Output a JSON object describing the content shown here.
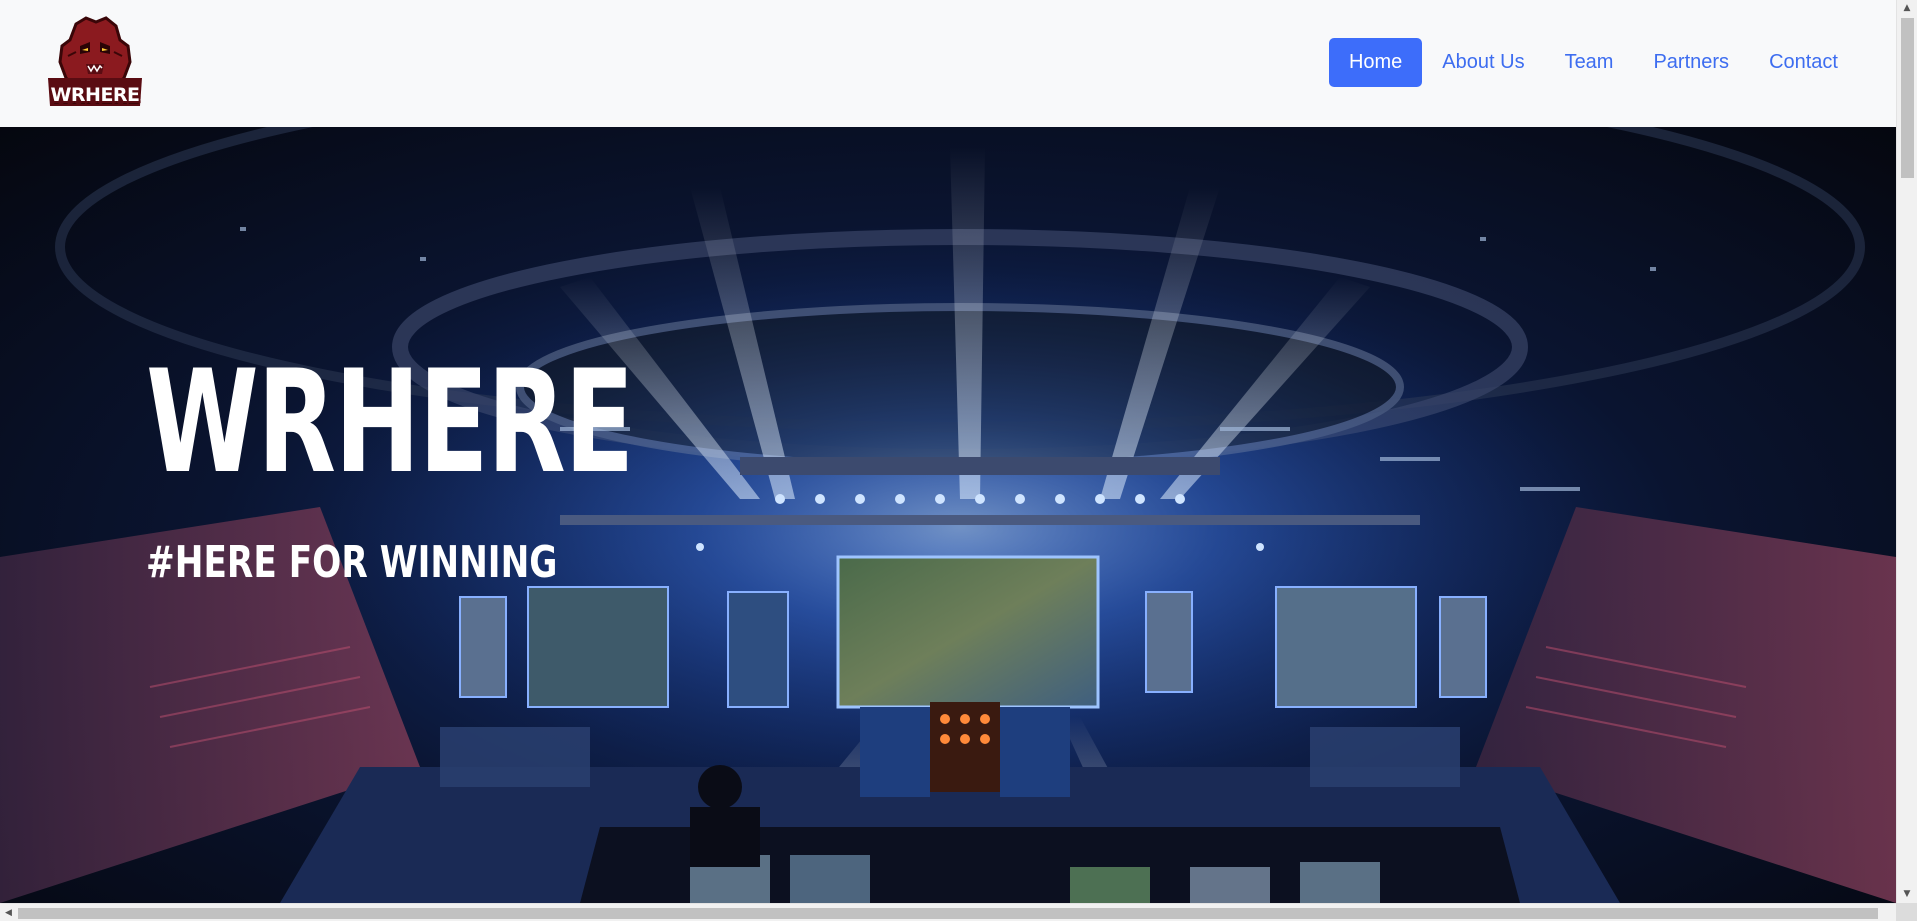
{
  "brand": {
    "logo_text": "WRHERE",
    "logo_icon": "gorilla-mascot-icon",
    "logo_color": "#8b1a1f"
  },
  "nav": {
    "items": [
      {
        "label": "Home",
        "active": true
      },
      {
        "label": "About Us",
        "active": false
      },
      {
        "label": "Team",
        "active": false
      },
      {
        "label": "Partners",
        "active": false
      },
      {
        "label": "Contact",
        "active": false
      }
    ],
    "active_color": "#3d6dfa",
    "link_color": "#3d6df0"
  },
  "hero": {
    "title": "WRHERE",
    "subtitle": "#HERE FOR WINNING",
    "background": "esports-arena-image"
  },
  "scrollbar": {
    "up_icon": "scroll-up-arrow-icon",
    "down_icon": "scroll-down-arrow-icon",
    "left_icon": "scroll-left-arrow-icon",
    "right_icon": "scroll-right-arrow-icon"
  }
}
